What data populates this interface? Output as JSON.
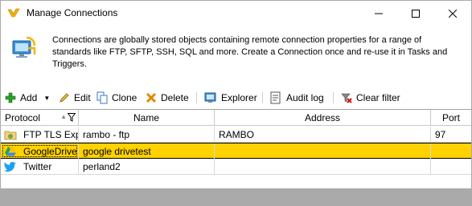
{
  "window": {
    "title": "Manage Connections",
    "icon": "v-logo-icon"
  },
  "intro": {
    "icon": "monitor-connection-icon",
    "text": "Connections are globally stored objects containing remote connection properties for a range of standards like FTP, SFTP,  SSH, SQL and more. Create a Connection once and re-use it in Tasks and Triggers."
  },
  "toolbar": {
    "add": "Add",
    "edit": "Edit",
    "clone": "Clone",
    "delete": "Delete",
    "explorer": "Explorer",
    "audit_log": "Audit log",
    "clear_filter": "Clear filter"
  },
  "grid": {
    "columns": {
      "protocol": "Protocol",
      "name": "Name",
      "address": "Address",
      "port": "Port"
    },
    "rows": [
      {
        "protocol": "FTP TLS Expl",
        "name": "rambo - ftp",
        "address": "RAMBO",
        "port": "97",
        "icon": "ftp-folder-icon",
        "selected": false
      },
      {
        "protocol": "GoogleDrive",
        "name": "google drivetest",
        "address": "",
        "port": "",
        "icon": "google-drive-icon",
        "selected": true
      },
      {
        "protocol": "Twitter",
        "name": "perland2",
        "address": "",
        "port": "",
        "icon": "twitter-icon",
        "selected": false
      }
    ]
  },
  "colors": {
    "selected_row": "#ffd200",
    "statusbar": "#aaaaaa"
  }
}
